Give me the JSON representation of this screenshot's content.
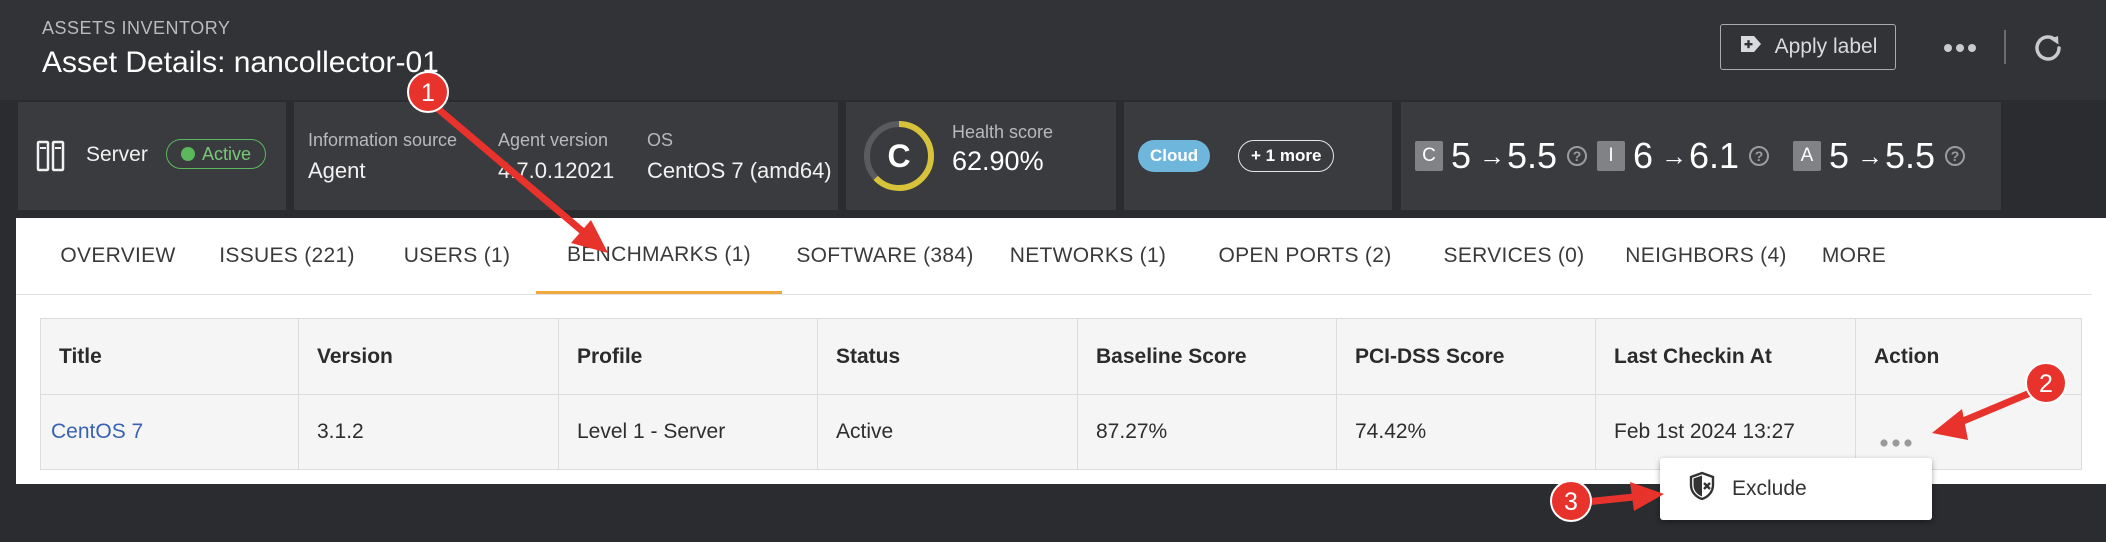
{
  "header": {
    "eyebrow": "ASSETS INVENTORY",
    "title": "Asset Details: nancollector-01",
    "apply_label": "Apply label"
  },
  "summary": {
    "type_label": "Server",
    "status": "Active",
    "info_source_label": "Information source",
    "info_source_value": "Agent",
    "agent_version_label": "Agent version",
    "agent_version_value": "4.7.0.12021",
    "os_label": "OS",
    "os_value": "CentOS 7 (amd64)",
    "health_grade": "C",
    "health_label": "Health score",
    "health_value": "62.90%",
    "health_percent": 62.9,
    "tags": {
      "primary": "Cloud",
      "more": "+ 1 more"
    },
    "cia": [
      {
        "letter": "C",
        "from": "5",
        "to": "5.5"
      },
      {
        "letter": "I",
        "from": "6",
        "to": "6.1"
      },
      {
        "letter": "A",
        "from": "5",
        "to": "5.5"
      }
    ],
    "cia_arrow": "→",
    "help_glyph": "?"
  },
  "tabs": [
    {
      "label": "OVERVIEW"
    },
    {
      "label": "ISSUES (221)"
    },
    {
      "label": "USERS (1)"
    },
    {
      "label": "BENCHMARKS (1)"
    },
    {
      "label": "SOFTWARE (384)"
    },
    {
      "label": "NETWORKS (1)"
    },
    {
      "label": "OPEN PORTS (2)"
    },
    {
      "label": "SERVICES (0)"
    },
    {
      "label": "NEIGHBORS (4)"
    },
    {
      "label": "MORE"
    }
  ],
  "active_tab": "BENCHMARKS (1)",
  "table": {
    "headers": [
      "Title",
      "Version",
      "Profile",
      "Status",
      "Baseline Score",
      "PCI-DSS Score",
      "Last Checkin At",
      "Action"
    ],
    "row": {
      "title": "CentOS 7",
      "version": "3.1.2",
      "profile": "Level 1 - Server",
      "status": "Active",
      "baseline_score": "87.27%",
      "pci_dss_score": "74.42%",
      "last_checkin": "Feb 1st 2024 13:27"
    }
  },
  "dropdown": {
    "exclude_label": "Exclude"
  },
  "annotations": [
    "1",
    "2",
    "3"
  ],
  "colors": {
    "accent_tab": "#f0a83c",
    "status_green": "#5cb85c",
    "health_ring": "#d8c23a",
    "cloud_tag": "#6fb6dc",
    "link_blue": "#3a62b3",
    "annotation_red": "#e8322c"
  }
}
